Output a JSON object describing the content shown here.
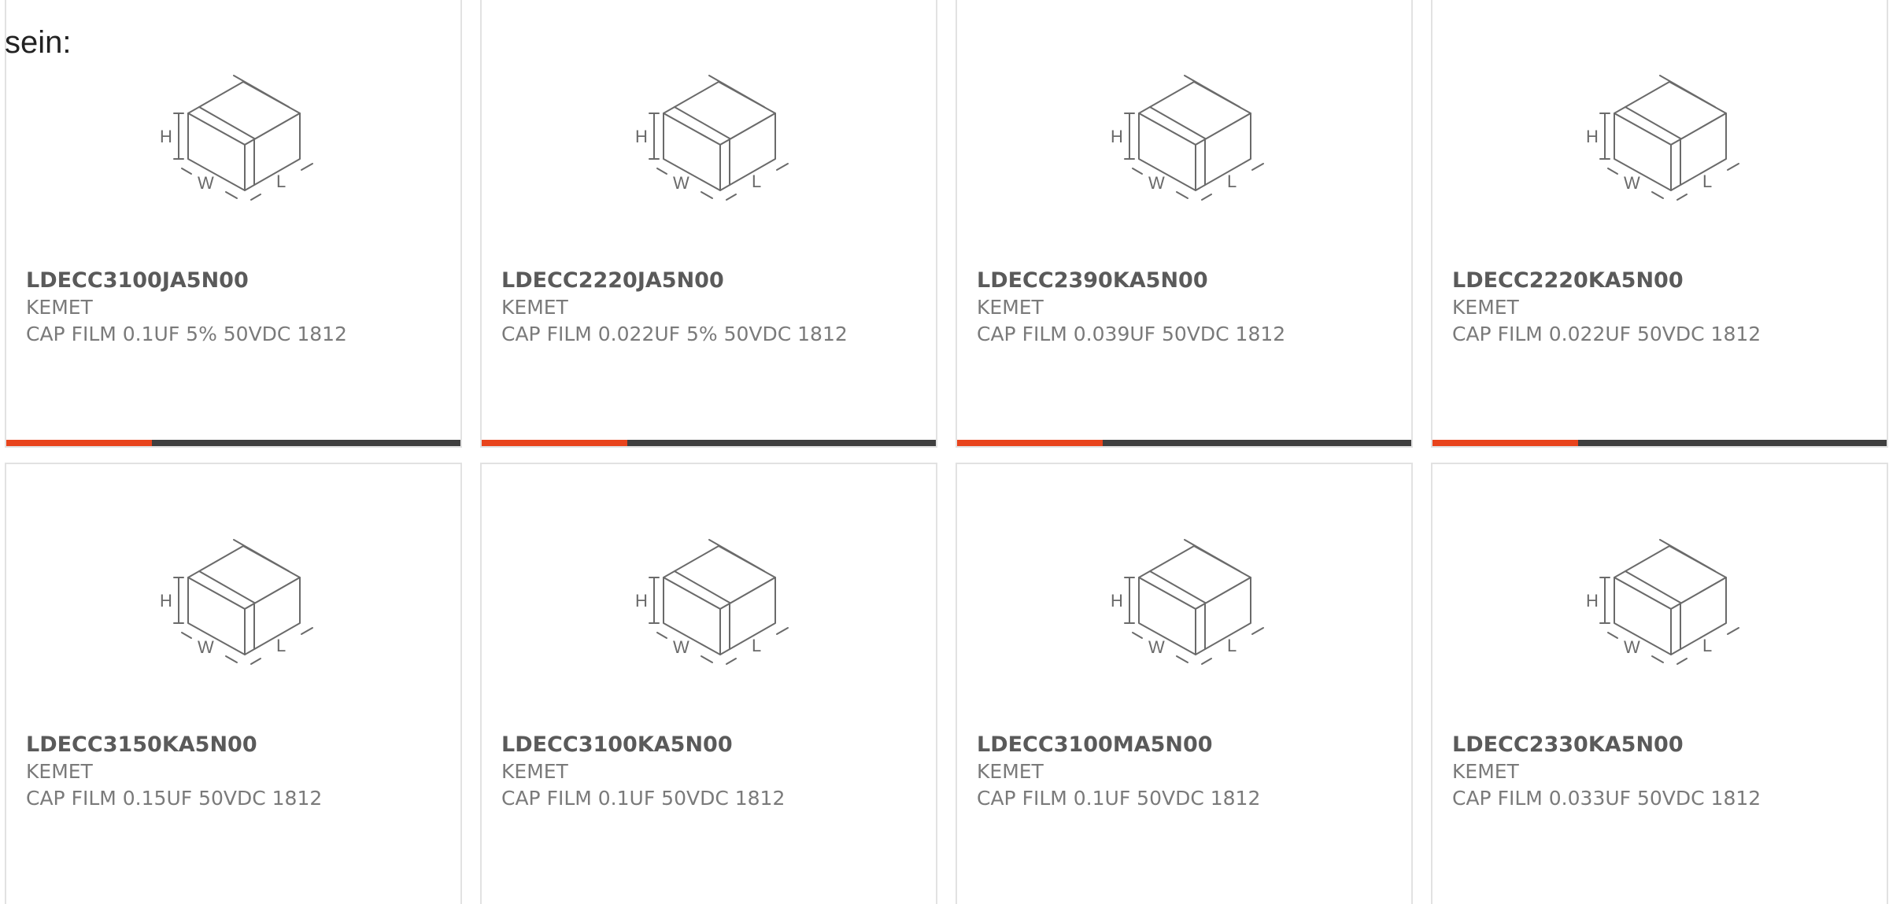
{
  "intro_text": "sein:",
  "colors": {
    "accent": "#e8441c",
    "bar_track": "#3f3f3f",
    "card_border": "#e2e2e2"
  },
  "image_icon": "capacitor-dimension-diagram-icon",
  "dimension_labels": {
    "height": "H",
    "width": "W",
    "length": "L"
  },
  "products": [
    {
      "part_number": "LDECC3100JA5N00",
      "manufacturer": "KEMET",
      "description": "CAP FILM 0.1UF 5% 50VDC 1812",
      "progress": 0.32
    },
    {
      "part_number": "LDECC2220JA5N00",
      "manufacturer": "KEMET",
      "description": "CAP FILM 0.022UF 5% 50VDC 1812",
      "progress": 0.32
    },
    {
      "part_number": "LDECC2390KA5N00",
      "manufacturer": "KEMET",
      "description": "CAP FILM 0.039UF 50VDC 1812",
      "progress": 0.32
    },
    {
      "part_number": "LDECC2220KA5N00",
      "manufacturer": "KEMET",
      "description": "CAP FILM 0.022UF 50VDC 1812",
      "progress": 0.32
    },
    {
      "part_number": "LDECC3150KA5N00",
      "manufacturer": "KEMET",
      "description": "CAP FILM 0.15UF 50VDC 1812"
    },
    {
      "part_number": "LDECC3100KA5N00",
      "manufacturer": "KEMET",
      "description": "CAP FILM 0.1UF 50VDC 1812"
    },
    {
      "part_number": "LDECC3100MA5N00",
      "manufacturer": "KEMET",
      "description": "CAP FILM 0.1UF 50VDC 1812"
    },
    {
      "part_number": "LDECC2330KA5N00",
      "manufacturer": "KEMET",
      "description": "CAP FILM 0.033UF 50VDC 1812"
    }
  ]
}
